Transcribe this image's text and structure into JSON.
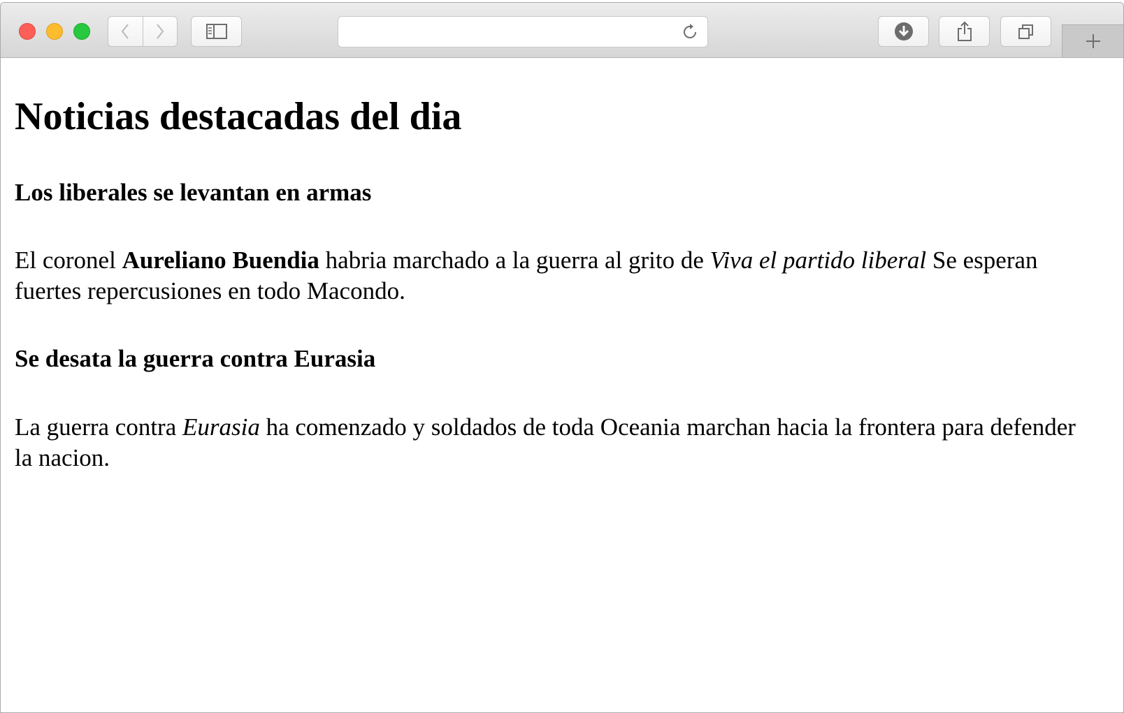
{
  "browser": {
    "address_value": "",
    "icons": {
      "close": "close-traffic-light",
      "minimize": "minimize-traffic-light",
      "zoom": "zoom-traffic-light",
      "back": "chevron-left-icon",
      "forward": "chevron-right-icon",
      "sidebar": "sidebar-icon",
      "reload": "reload-icon",
      "download": "download-icon",
      "share": "share-icon",
      "tabs": "tabs-overview-icon",
      "new_tab": "plus-icon"
    },
    "colors": {
      "close": "#fc5f57",
      "minimize": "#fdbc2e",
      "zoom": "#28c840"
    }
  },
  "page": {
    "title": "Noticias destacadas del dia",
    "articles": [
      {
        "heading": "Los liberales se levantan en armas",
        "body_1": "El coronel ",
        "strong": "Aureliano Buendia",
        "body_2": " habria marchado a la guerra al grito de ",
        "em": "Viva el partido liberal",
        "body_3": " Se esperan fuertes repercusiones en todo Macondo."
      },
      {
        "heading": "Se desata la guerra contra Eurasia",
        "body_1": "La guerra contra ",
        "em": "Eurasia",
        "body_2": " ha comenzado y soldados de toda Oceania marchan hacia la frontera para defender la nacion."
      }
    ]
  }
}
